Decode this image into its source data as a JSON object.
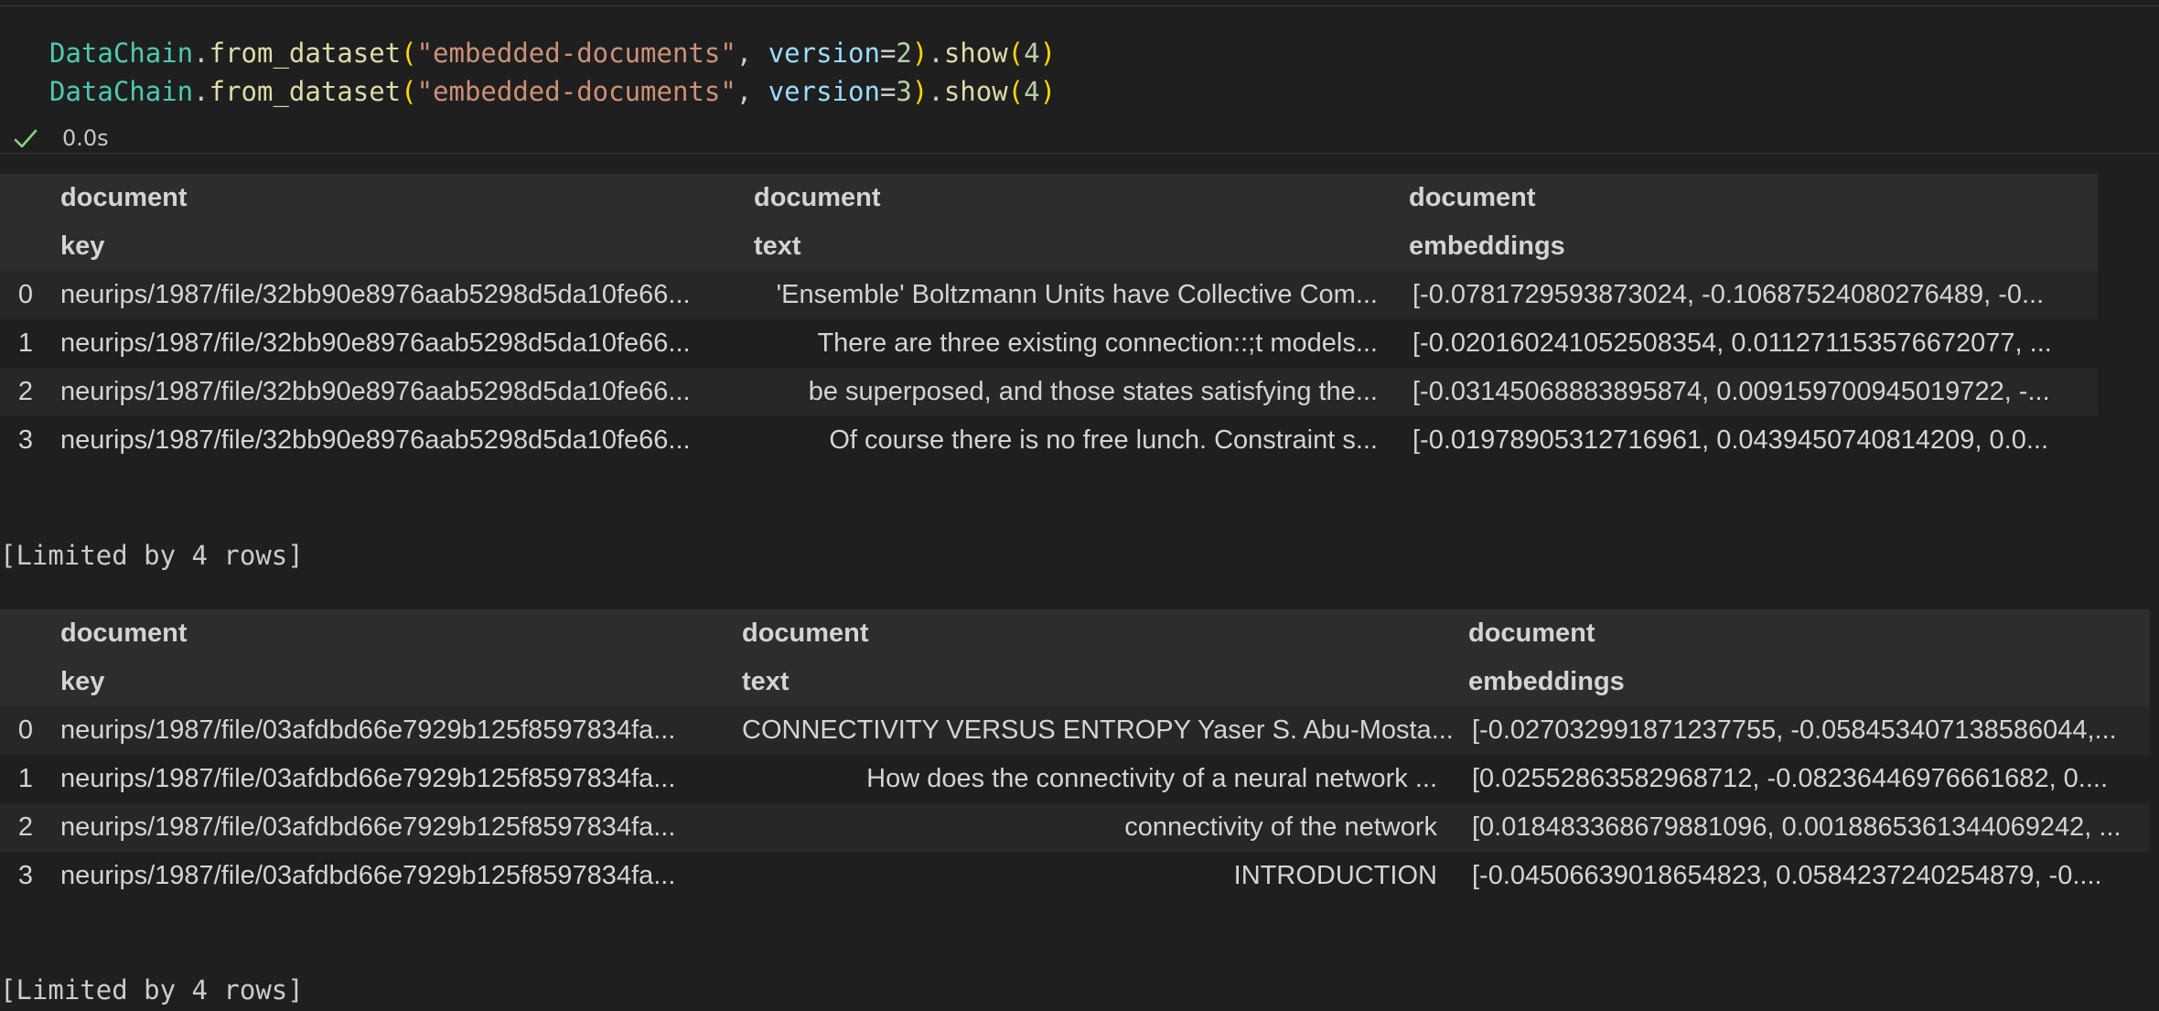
{
  "code": {
    "lines": [
      {
        "cls": "DataChain",
        "dot": ".",
        "fn": "from_dataset",
        "open": "(",
        "str": "\"embedded-documents\"",
        "comma": ", ",
        "param": "version",
        "eq": "=",
        "num": "2",
        "close": ")",
        "dot2": ".",
        "fn2": "show",
        "open2": "(",
        "num2": "4",
        "close2": ")"
      },
      {
        "cls": "DataChain",
        "dot": ".",
        "fn": "from_dataset",
        "open": "(",
        "str": "\"embedded-documents\"",
        "comma": ", ",
        "param": "version",
        "eq": "=",
        "num": "3",
        "close": ")",
        "dot2": ".",
        "fn2": "show",
        "open2": "(",
        "num2": "4",
        "close2": ")"
      }
    ]
  },
  "status": {
    "icon": "check-icon",
    "exec_time": "0.0s",
    "success_color": "#89d185"
  },
  "tables": [
    {
      "header_top": [
        "",
        "document",
        "document",
        "document"
      ],
      "header_sub": [
        "",
        "key",
        "text",
        "embeddings"
      ],
      "rows": [
        {
          "idx": "0",
          "key": "neurips/1987/file/32bb90e8976aab5298d5da10fe66...",
          "text": "'Ensemble' Boltzmann Units have Collective Com...",
          "emb": "[-0.0781729593873024, -0.10687524080276489, -0..."
        },
        {
          "idx": "1",
          "key": "neurips/1987/file/32bb90e8976aab5298d5da10fe66...",
          "text": "There are three existing connection::;t models...",
          "emb": "[-0.020160241052508354, 0.011271153576672077, ..."
        },
        {
          "idx": "2",
          "key": "neurips/1987/file/32bb90e8976aab5298d5da10fe66...",
          "text": "be superposed, and those states satisfying the...",
          "emb": "[-0.03145068883895874, 0.009159700945019722, -..."
        },
        {
          "idx": "3",
          "key": "neurips/1987/file/32bb90e8976aab5298d5da10fe66...",
          "text": "Of course there is no free lunch. Constraint s...",
          "emb": "[-0.01978905312716961, 0.0439450740814209, 0.0..."
        }
      ],
      "footer": "[Limited by 4 rows]"
    },
    {
      "header_top": [
        "",
        "document",
        "document",
        "document"
      ],
      "header_sub": [
        "",
        "key",
        "text",
        "embeddings"
      ],
      "rows": [
        {
          "idx": "0",
          "key": "neurips/1987/file/03afdbd66e7929b125f8597834fa...",
          "text": "CONNECTIVITY VERSUS ENTROPY Yaser S. Abu-Mosta...",
          "emb": "[-0.027032991871237755, -0.058453407138586044,..."
        },
        {
          "idx": "1",
          "key": "neurips/1987/file/03afdbd66e7929b125f8597834fa...",
          "text": "How does the connectivity of a neural network ...",
          "emb": "[0.02552863582968712, -0.08236446976661682, 0...."
        },
        {
          "idx": "2",
          "key": "neurips/1987/file/03afdbd66e7929b125f8597834fa...",
          "text": "connectivity of the network",
          "emb": "[0.018483368679881096, 0.0018865361344069242, ..."
        },
        {
          "idx": "3",
          "key": "neurips/1987/file/03afdbd66e7929b125f8597834fa...",
          "text": "INTRODUCTION",
          "emb": "[-0.04506639018654823, 0.0584237240254879, -0...."
        }
      ],
      "footer": "[Limited by 4 rows]"
    }
  ]
}
